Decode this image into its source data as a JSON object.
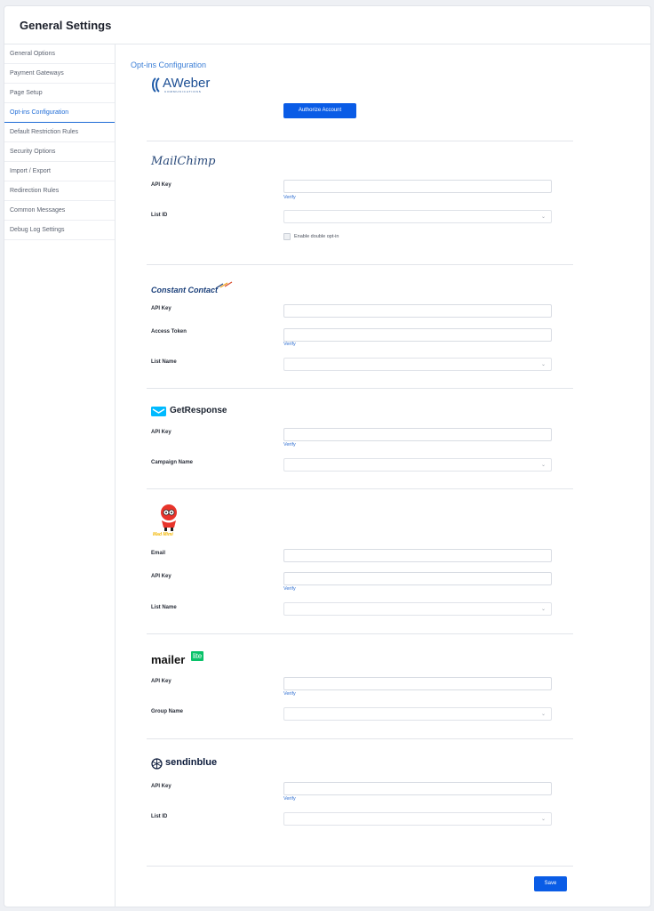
{
  "header": {
    "title": "General Settings"
  },
  "sidebar": {
    "items": [
      {
        "label": "General Options"
      },
      {
        "label": "Payment Gateways"
      },
      {
        "label": "Page Setup"
      },
      {
        "label": "Opt-ins Configuration"
      },
      {
        "label": "Default Restriction Rules"
      },
      {
        "label": "Security Options"
      },
      {
        "label": "Import / Export"
      },
      {
        "label": "Redirection Rules"
      },
      {
        "label": "Common Messages"
      },
      {
        "label": "Debug Log Settings"
      }
    ],
    "active_index": 3
  },
  "main": {
    "section_title": "Opt-ins Configuration",
    "aweber": {
      "logo": "AWeber",
      "logo_sub": "COMMUNICATIONS",
      "authorize_label": "Authorize Account"
    },
    "mailchimp": {
      "logo": "MailChimp",
      "api_key_label": "API Key",
      "verify_label": "Verify",
      "list_id_label": "List ID",
      "double_optin_label": "Enable double opt-in"
    },
    "constant_contact": {
      "logo": "Constant Contact",
      "api_key_label": "API Key",
      "access_token_label": "Access Token",
      "verify_label": "Verify",
      "list_name_label": "List Name"
    },
    "getresponse": {
      "logo": "GetResponse",
      "api_key_label": "API Key",
      "verify_label": "Verify",
      "campaign_label": "Campaign Name"
    },
    "mad_mimi": {
      "logo": "Mad Mimi",
      "email_label": "Email",
      "api_key_label": "API Key",
      "verify_label": "Verify",
      "list_name_label": "List Name"
    },
    "mailerlite": {
      "logo": "mailer",
      "logo_badge": "lite",
      "api_key_label": "API Key",
      "verify_label": "Verify",
      "group_label": "Group Name"
    },
    "sendinblue": {
      "logo": "sendinblue",
      "api_key_label": "API Key",
      "verify_label": "Verify",
      "list_id_label": "List ID"
    },
    "save_label": "Save"
  },
  "colors": {
    "accent": "#0a5ce6",
    "link": "#2f6fd1",
    "active_nav": "#1e6bd6"
  },
  "icons": [
    "chevron-down-icon",
    "getresponse-envelope-icon",
    "sendinblue-icon",
    "mad-mimi-mascot-icon"
  ]
}
